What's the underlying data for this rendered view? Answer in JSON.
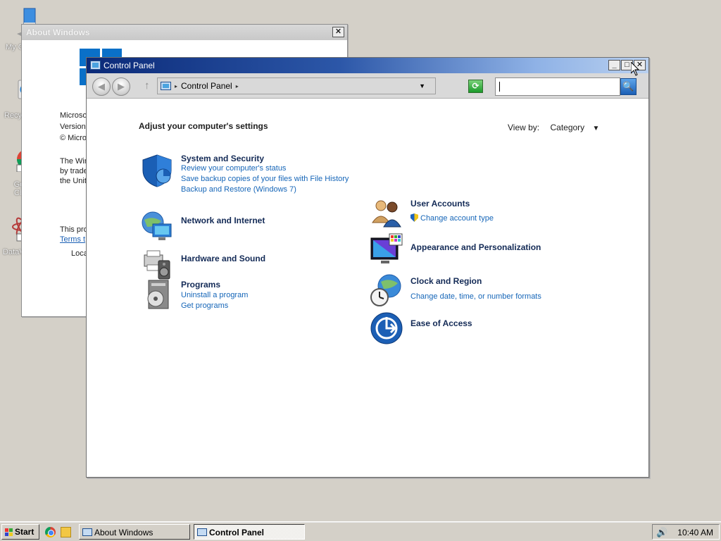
{
  "desktop": {
    "icons": [
      {
        "label": "My C"
      },
      {
        "label": "Recy"
      },
      {
        "label": "Go Ch"
      },
      {
        "label": "DataV"
      }
    ]
  },
  "about_window": {
    "title": "About Windows",
    "close": "✕",
    "lines": [
      "Microso",
      "Version",
      "© Micro",
      "The Win",
      "by trade",
      "the Unit",
      "This pro",
      "Terms t",
      "Loca"
    ]
  },
  "control_panel": {
    "title": "Control Panel",
    "controls": {
      "min": "_",
      "max": "□",
      "close": "✕"
    },
    "toolbar": {
      "back": "◀",
      "forward": "▶",
      "up": "↑",
      "address_sep": "▸",
      "address": "Control Panel",
      "address_dropdown": "▼",
      "refresh": "⟳",
      "search_value": "",
      "search_icon": "🔍"
    },
    "heading": "Adjust your computer's settings",
    "view_by": {
      "label": "View by:",
      "value": "Category",
      "arrow": "▼"
    },
    "categories": {
      "system": {
        "title": "System and Security",
        "links": [
          "Review your computer's status",
          "Save backup copies of your files with File History",
          "Backup and Restore (Windows 7)"
        ]
      },
      "network": {
        "title": "Network and Internet"
      },
      "hardware": {
        "title": "Hardware and Sound"
      },
      "programs": {
        "title": "Programs",
        "links": [
          "Uninstall a program",
          "Get programs"
        ]
      },
      "users": {
        "title": "User Accounts",
        "links": [
          "Change account type"
        ]
      },
      "appearance": {
        "title": "Appearance and Personalization"
      },
      "clock": {
        "title": "Clock and Region",
        "links": [
          "Change date, time, or number formats"
        ]
      },
      "ease": {
        "title": "Ease of Access"
      }
    }
  },
  "taskbar": {
    "start": "Start",
    "tasks": [
      {
        "label": "About Windows",
        "active": false
      },
      {
        "label": "Control Panel",
        "active": true
      }
    ],
    "volume_icon": "🔊",
    "clock": "10:40 AM"
  },
  "colors": {
    "title_active": "#0b2a78",
    "link": "#1666b8",
    "category_title": "#132a56",
    "desktop": "#d4d0c8"
  }
}
